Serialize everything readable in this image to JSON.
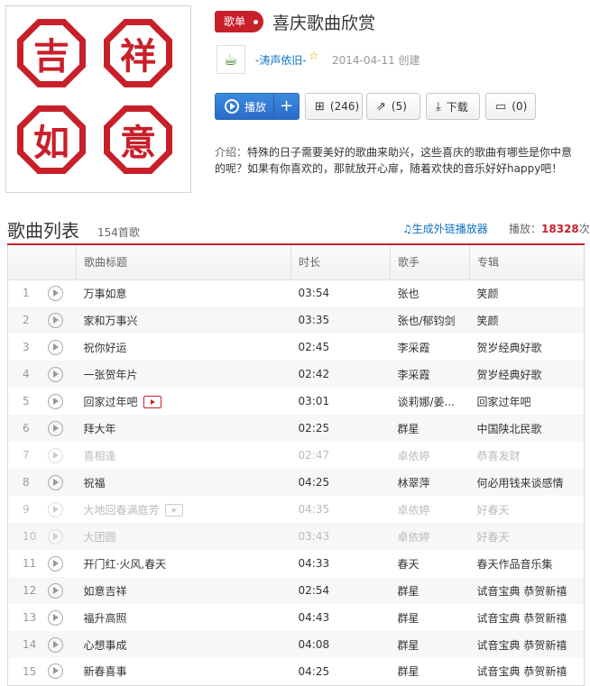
{
  "playlist": {
    "tag": "歌单",
    "title": "喜庆歌曲欣赏",
    "cover_chars": [
      "吉",
      "祥",
      "如",
      "意"
    ],
    "creator": "-涛声依旧-",
    "created": "2014-04-11 创建",
    "intro_label": "介绍：",
    "intro": "特殊的日子需要美好的歌曲来助兴，这些喜庆的歌曲有哪些是你中意的呢？如果有你喜欢的，那就放开心扉，随着欢快的音乐好好happy吧！"
  },
  "actions": {
    "play": "播放",
    "add": "+",
    "collect": "(246)",
    "share": "(5)",
    "download": "下载",
    "comment": "(0)"
  },
  "list": {
    "title": "歌曲列表",
    "count": "154首歌",
    "outchain": "生成外链播放器",
    "plays_label": "播放：",
    "plays_value": "18328",
    "plays_unit": "次",
    "headers": [
      "歌曲标题",
      "时长",
      "歌手",
      "专辑"
    ]
  },
  "songs": [
    {
      "n": "1",
      "title": "万事如意",
      "time": "03:54",
      "artist": "张也",
      "album": "笑颜"
    },
    {
      "n": "2",
      "title": "家和万事兴",
      "time": "03:35",
      "artist": "张也/郁钧剑",
      "album": "笑颜"
    },
    {
      "n": "3",
      "title": "祝你好运",
      "time": "02:45",
      "artist": "李采霞",
      "album": "贺岁经典好歌"
    },
    {
      "n": "4",
      "title": "一张贺年片",
      "time": "02:42",
      "artist": "李采霞",
      "album": "贺岁经典好歌"
    },
    {
      "n": "5",
      "title": "回家过年吧",
      "time": "03:01",
      "artist": "谈莉娜/姜...",
      "album": "回家过年吧"
    },
    {
      "n": "6",
      "title": "拜大年",
      "time": "02:25",
      "artist": "群星",
      "album": "中国陕北民歌"
    },
    {
      "n": "7",
      "title": "喜相逢",
      "time": "02:47",
      "artist": "卓依婷",
      "album": "恭喜发财"
    },
    {
      "n": "8",
      "title": "祝福",
      "time": "04:25",
      "artist": "林翠萍",
      "album": "何必用钱来谈感情"
    },
    {
      "n": "9",
      "title": "大地回春满庭芳",
      "time": "04:35",
      "artist": "卓依婷",
      "album": "好春天"
    },
    {
      "n": "10",
      "title": "大团圆",
      "time": "03:43",
      "artist": "卓依婷",
      "album": "好春天"
    },
    {
      "n": "11",
      "title": "开门红·火风,春天",
      "time": "04:33",
      "artist": "春天",
      "album": "春天作品音乐集"
    },
    {
      "n": "12",
      "title": "如意吉祥",
      "time": "02:54",
      "artist": "群星",
      "album": "试音宝典 恭贺新禧"
    },
    {
      "n": "13",
      "title": "福升高照",
      "time": "04:43",
      "artist": "群星",
      "album": "试音宝典 恭贺新禧"
    },
    {
      "n": "14",
      "title": "心想事成",
      "time": "04:08",
      "artist": "群星",
      "album": "试音宝典 恭贺新禧"
    },
    {
      "n": "15",
      "title": "新春喜事",
      "time": "04:25",
      "artist": "群星",
      "album": "试音宝典 恭贺新禧"
    }
  ]
}
